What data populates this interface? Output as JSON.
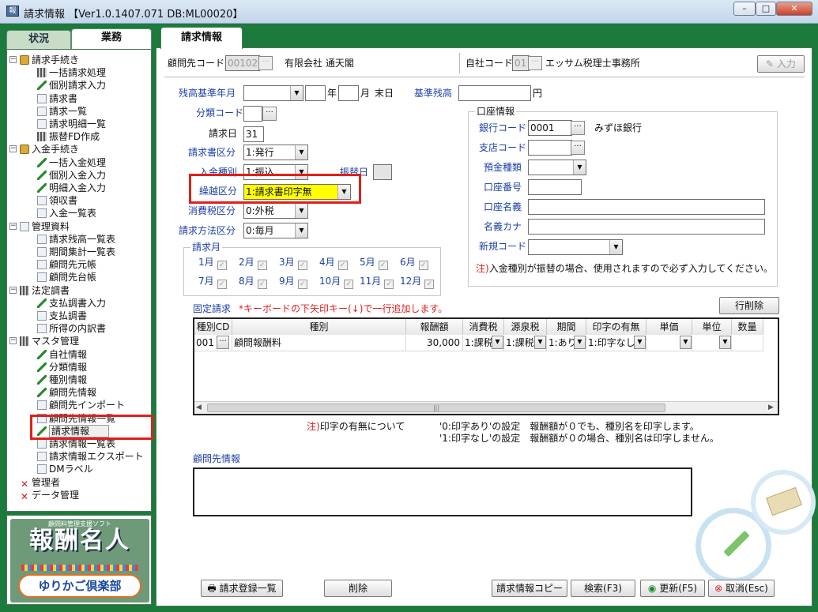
{
  "window": {
    "title": "請求情報 【Ver1.0.1407.071 DB:ML00020】",
    "app_icon_label": "報",
    "buttons": [
      "–",
      "□",
      "✕"
    ]
  },
  "left_tabs": [
    "状況",
    "業務"
  ],
  "tree": [
    {
      "label": "請求手続き",
      "level": 0,
      "icon": "folder-icon",
      "expanded": true
    },
    {
      "label": "一括請求処理",
      "level": 1,
      "icon": "grid-icon"
    },
    {
      "label": "個別請求入力",
      "level": 1,
      "icon": "pen-icon"
    },
    {
      "label": "請求書",
      "level": 1,
      "icon": "document-icon"
    },
    {
      "label": "請求一覧",
      "level": 1,
      "icon": "document-icon"
    },
    {
      "label": "請求明細一覧",
      "level": 1,
      "icon": "document-icon"
    },
    {
      "label": "振替FD作成",
      "level": 1,
      "icon": "disk-icon"
    },
    {
      "label": "入金手続き",
      "level": 0,
      "icon": "folder-icon",
      "expanded": true
    },
    {
      "label": "一括入金処理",
      "level": 1,
      "icon": "pen-icon"
    },
    {
      "label": "個別入金入力",
      "level": 1,
      "icon": "pen-icon"
    },
    {
      "label": "明細入金入力",
      "level": 1,
      "icon": "pen-icon"
    },
    {
      "label": "領収書",
      "level": 1,
      "icon": "document-icon"
    },
    {
      "label": "入金一覧表",
      "level": 1,
      "icon": "document-icon"
    },
    {
      "label": "管理資料",
      "level": 0,
      "icon": "document-icon",
      "expanded": true
    },
    {
      "label": "請求残高一覧表",
      "level": 1,
      "icon": "document-icon"
    },
    {
      "label": "期間集計一覧表",
      "level": 1,
      "icon": "document-icon"
    },
    {
      "label": "顧問先元帳",
      "level": 1,
      "icon": "document-icon"
    },
    {
      "label": "顧問先台帳",
      "level": 1,
      "icon": "document-icon"
    },
    {
      "label": "法定調書",
      "level": 0,
      "icon": "grid-icon",
      "expanded": true
    },
    {
      "label": "支払調書入力",
      "level": 1,
      "icon": "pen-icon"
    },
    {
      "label": "支払調書",
      "level": 1,
      "icon": "document-icon"
    },
    {
      "label": "所得の内訳書",
      "level": 1,
      "icon": "document-icon"
    },
    {
      "label": "マスタ管理",
      "level": 0,
      "icon": "grid-icon",
      "expanded": true
    },
    {
      "label": "自社情報",
      "level": 1,
      "icon": "pen-icon"
    },
    {
      "label": "分類情報",
      "level": 1,
      "icon": "pen-icon"
    },
    {
      "label": "種別情報",
      "level": 1,
      "icon": "pen-icon"
    },
    {
      "label": "顧問先情報",
      "level": 1,
      "icon": "pen-icon"
    },
    {
      "label": "顧問先インポート",
      "level": 1,
      "icon": "import-icon"
    },
    {
      "label": "顧問先情報一覧",
      "level": 1,
      "icon": "document-icon"
    },
    {
      "label": "請求情報",
      "level": 1,
      "icon": "pen-icon",
      "selected": true
    },
    {
      "label": "請求情報一覧表",
      "level": 1,
      "icon": "document-icon"
    },
    {
      "label": "請求情報エクスポート",
      "level": 1,
      "icon": "export-icon"
    },
    {
      "label": "DMラベル",
      "level": 1,
      "icon": "document-icon"
    },
    {
      "label": "管理者",
      "level": 0,
      "icon": "x-icon"
    },
    {
      "label": "データ管理",
      "level": 0,
      "icon": "x-icon"
    }
  ],
  "logo": {
    "subtitle": "顧問料管理支援ソフト",
    "name": "報酬名人",
    "brand": "ゆりかご倶楽部"
  },
  "main_tab": "請求情報",
  "header": {
    "client_code_label": "顧問先コード",
    "client_code": "00102",
    "client_name": "有限会社 通天閣",
    "own_code_label": "自社コード",
    "own_code": "01",
    "own_name": "エッサム税理士事務所",
    "input_button": "入力"
  },
  "form": {
    "balance_month_label": "残高基準年月",
    "year_suffix": "年",
    "month_suffix": "月",
    "end_label": "末日",
    "base_balance_label": "基準残高",
    "yen": "円",
    "category_code_label": "分類コード",
    "billing_day_label": "請求日",
    "billing_day": "31",
    "invoice_type_label": "請求書区分",
    "invoice_type": "1:発行",
    "payment_type_label": "入金種別",
    "payment_type": "1:振込",
    "transfer_day_label": "振替日",
    "carryover_label": "繰越区分",
    "carryover": "1:請求書印字無",
    "tax_type_label": "消費税区分",
    "tax_type": "0:外税",
    "billing_method_label": "請求方法区分",
    "billing_method": "0:毎月",
    "months_title": "請求月",
    "months": [
      "1月",
      "2月",
      "3月",
      "4月",
      "5月",
      "6月",
      "7月",
      "8月",
      "9月",
      "10月",
      "11月",
      "12月"
    ]
  },
  "account": {
    "title": "口座情報",
    "bank_code_label": "銀行コード",
    "bank_code": "0001",
    "bank_name": "みずほ銀行",
    "branch_code_label": "支店コード",
    "deposit_type_label": "預金種類",
    "account_no_label": "口座番号",
    "account_name_label": "口座名義",
    "account_kana_label": "名義カナ",
    "new_code_label": "新規コード",
    "note_prefix": "注)",
    "note": "入金種別が振替の場合、使用されますので必ず入力してください。"
  },
  "fixed": {
    "title": "固定請求",
    "hint": "*キーボードの下矢印キー(↓)で一行追加します。",
    "delete_row_button": "行削除",
    "columns": [
      "種別CD",
      "種別",
      "報酬額",
      "消費税",
      "源泉税",
      "期間",
      "印字の有無",
      "単価",
      "単位",
      "数量"
    ],
    "rows": [
      {
        "code": "001",
        "type": "顧問報酬料",
        "amount": "30,000",
        "tax": "1:課税",
        "withholding": "1:課税",
        "period": "1:あり",
        "print": "1:印字なし",
        "unit_price": "",
        "unit": "",
        "qty": ""
      }
    ],
    "note_prefix": "注)",
    "note_title": "印字の有無について",
    "note_line1": "'0:印字あり'の設定　報酬額が０でも、種別名を印字します。",
    "note_line2": "'1:印字なし'の設定　報酬額が０の場合、種別名は印字しません。"
  },
  "client_info_label": "顧問先情報",
  "buttons": {
    "list": "請求登録一覧",
    "delete": "削除",
    "copy": "請求情報コピー",
    "search": "検索(F3)",
    "update": "更新(F5)",
    "cancel": "取消(Esc)"
  },
  "colors": {
    "frame_green": "#1b7a3c",
    "label_blue": "#1d3fa7",
    "highlight_red": "#e0201c",
    "selected_yellow": "#ffff00"
  }
}
